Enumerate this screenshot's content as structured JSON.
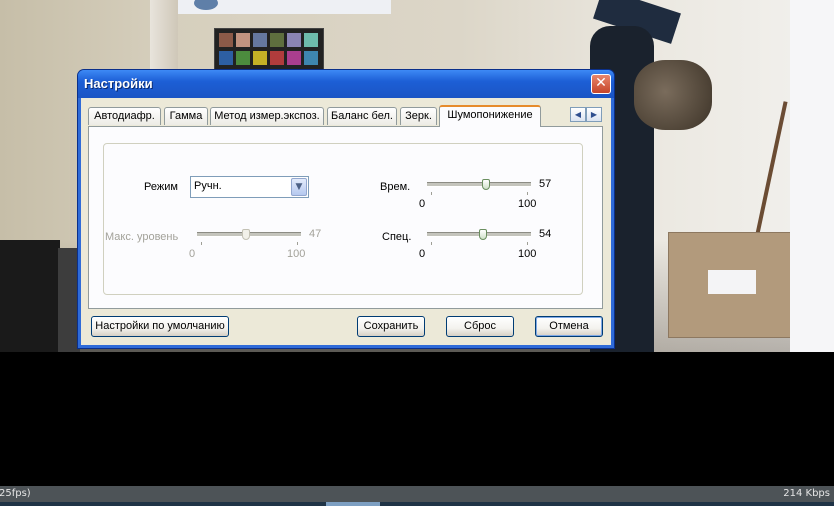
{
  "dialog": {
    "title": "Настройки",
    "close_label": "✕",
    "tabs": [
      {
        "label": "Автодиафр.",
        "active": false
      },
      {
        "label": "Гамма",
        "active": false
      },
      {
        "label": "Метод измер.экспоз.",
        "active": false
      },
      {
        "label": "Баланс бел.",
        "active": false
      },
      {
        "label": "Зерк.",
        "active": false
      },
      {
        "label": "Шумопонижение",
        "active": true
      }
    ],
    "tab_scroll": {
      "left": "◀",
      "right": "▶"
    },
    "mode": {
      "label": "Режим",
      "value": "Ручн.",
      "dropdown_glyph": "▼"
    },
    "max_level": {
      "label": "Макс. уровень",
      "value": "47",
      "min": "0",
      "max": "100",
      "fraction": 0.47,
      "enabled": false
    },
    "time": {
      "label": "Врем.",
      "value": "57",
      "min": "0",
      "max": "100",
      "fraction": 0.57,
      "enabled": true
    },
    "spec": {
      "label": "Спец.",
      "value": "54",
      "min": "0",
      "max": "100",
      "fraction": 0.54,
      "enabled": true
    },
    "buttons": {
      "defaults": "Настройки по умолчанию",
      "save": "Сохранить",
      "reset": "Сброс",
      "cancel": "Отмена"
    }
  },
  "statusbar": {
    "left_text": "25fps)",
    "right_text": "214 Kbps"
  },
  "colors": {
    "xp_title_blue": "#1d5fd6",
    "dialog_face": "#ece9d8",
    "active_tab_accent": "#e68b2c",
    "close_red": "#c6452a"
  }
}
